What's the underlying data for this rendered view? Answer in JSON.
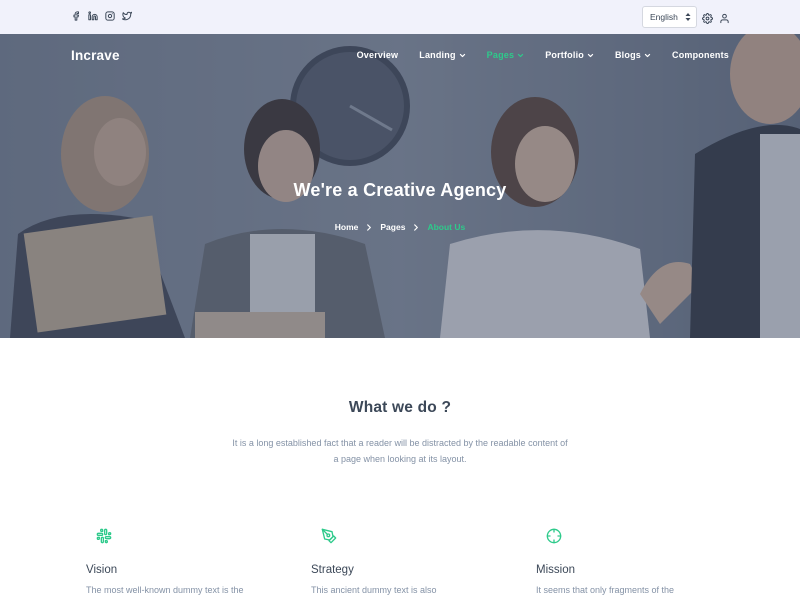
{
  "topbar": {
    "social_icons": [
      "facebook-icon",
      "linkedin-icon",
      "instagram-icon",
      "twitter-icon"
    ],
    "language": {
      "selected": "English"
    },
    "icons": [
      "settings-icon",
      "user-icon"
    ]
  },
  "nav": {
    "brand": "Incrave",
    "items": [
      {
        "label": "Overview",
        "has_dropdown": false
      },
      {
        "label": "Landing",
        "has_dropdown": true
      },
      {
        "label": "Pages",
        "has_dropdown": true,
        "active": true
      },
      {
        "label": "Portfolio",
        "has_dropdown": true
      },
      {
        "label": "Blogs",
        "has_dropdown": true
      },
      {
        "label": "Components",
        "has_dropdown": false
      }
    ]
  },
  "hero": {
    "title": "We're a Creative Agency",
    "breadcrumb": [
      "Home",
      "Pages",
      "About Us"
    ]
  },
  "section": {
    "title": "What we do ?",
    "description": "It is a long established fact that a reader will be distracted by the readable content of a page when looking at its layout."
  },
  "features": [
    {
      "icon": "slack-icon",
      "title": "Vision",
      "text": "The most well-known dummy text is the"
    },
    {
      "icon": "pen-tool-icon",
      "title": "Strategy",
      "text": "This ancient dummy text is also"
    },
    {
      "icon": "crosshair-icon",
      "title": "Mission",
      "text": "It seems that only fragments of the"
    }
  ],
  "colors": {
    "accent": "#2eca8b",
    "topbar_bg": "#f1f2fb",
    "heading": "#3c4858",
    "muted": "#8492a6"
  }
}
